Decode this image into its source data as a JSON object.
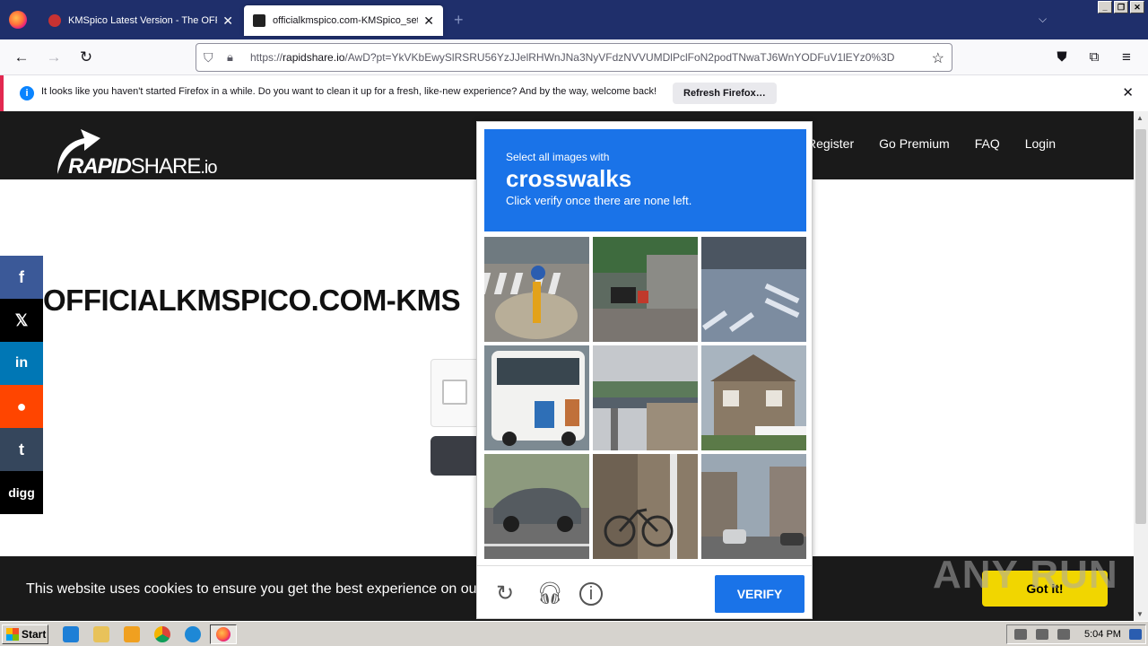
{
  "browser": {
    "tabs": [
      {
        "title": "KMSpico Latest Version - The OFFICIA",
        "active": false
      },
      {
        "title": "officialkmspico.com-KMSpico_setup",
        "active": true
      }
    ],
    "url": {
      "prefix": "https://",
      "domain": "rapidshare.io",
      "path": "/AwD?pt=YkVKbEwySlRSRU56YzJJelRHWnJNa3NyVFdzNVVUMDlPclFoN2podTNwaTJ6WnYODFuV1lEYz0%3D"
    }
  },
  "notification": {
    "text": "It looks like you haven't started Firefox in a while. Do you want to clean it up for a fresh, like-new experience? And by the way, welcome back!",
    "button": "Refresh Firefox…"
  },
  "site": {
    "logo": {
      "bold": "RAPID",
      "light": "SHARE",
      "suffix": ".io"
    },
    "nav": [
      "Register",
      "Go Premium",
      "FAQ",
      "Login"
    ],
    "title": "OFFICIALKMSPICO.COM-KMS",
    "share": [
      {
        "name": "facebook",
        "glyph": "f",
        "color": "#3b5998"
      },
      {
        "name": "x",
        "glyph": "𝕏",
        "color": "#000000"
      },
      {
        "name": "linkedin",
        "glyph": "in",
        "color": "#0077b5"
      },
      {
        "name": "reddit",
        "glyph": "●",
        "color": "#ff4500"
      },
      {
        "name": "tumblr",
        "glyph": "t",
        "color": "#35465c"
      },
      {
        "name": "digg",
        "glyph": "digg",
        "color": "#000000"
      }
    ],
    "cookie_text": "This website uses cookies to ensure you get the best experience on our website.",
    "cookie_button": "Got it!",
    "watermark": "ANY RUN"
  },
  "captcha": {
    "instruction_small": "Select all images with",
    "instruction_big": "crosswalks",
    "instruction_sub": "Click verify once there are none left.",
    "tiles": [
      "crosswalk-with-bollard",
      "motorbikes-storefront",
      "crosswalk-street",
      "bus",
      "bridge-buildings",
      "house",
      "car-road",
      "bicycle-alley",
      "town-street"
    ],
    "verify": "VERIFY",
    "icons": [
      "reload-icon",
      "audio-icon",
      "info-icon"
    ]
  },
  "taskbar": {
    "start": "Start",
    "clock": "5:04 PM"
  },
  "colors": {
    "accent": "#1a73e8",
    "cookie_button": "#f1d600",
    "tabbar": "#1f2f6b"
  }
}
